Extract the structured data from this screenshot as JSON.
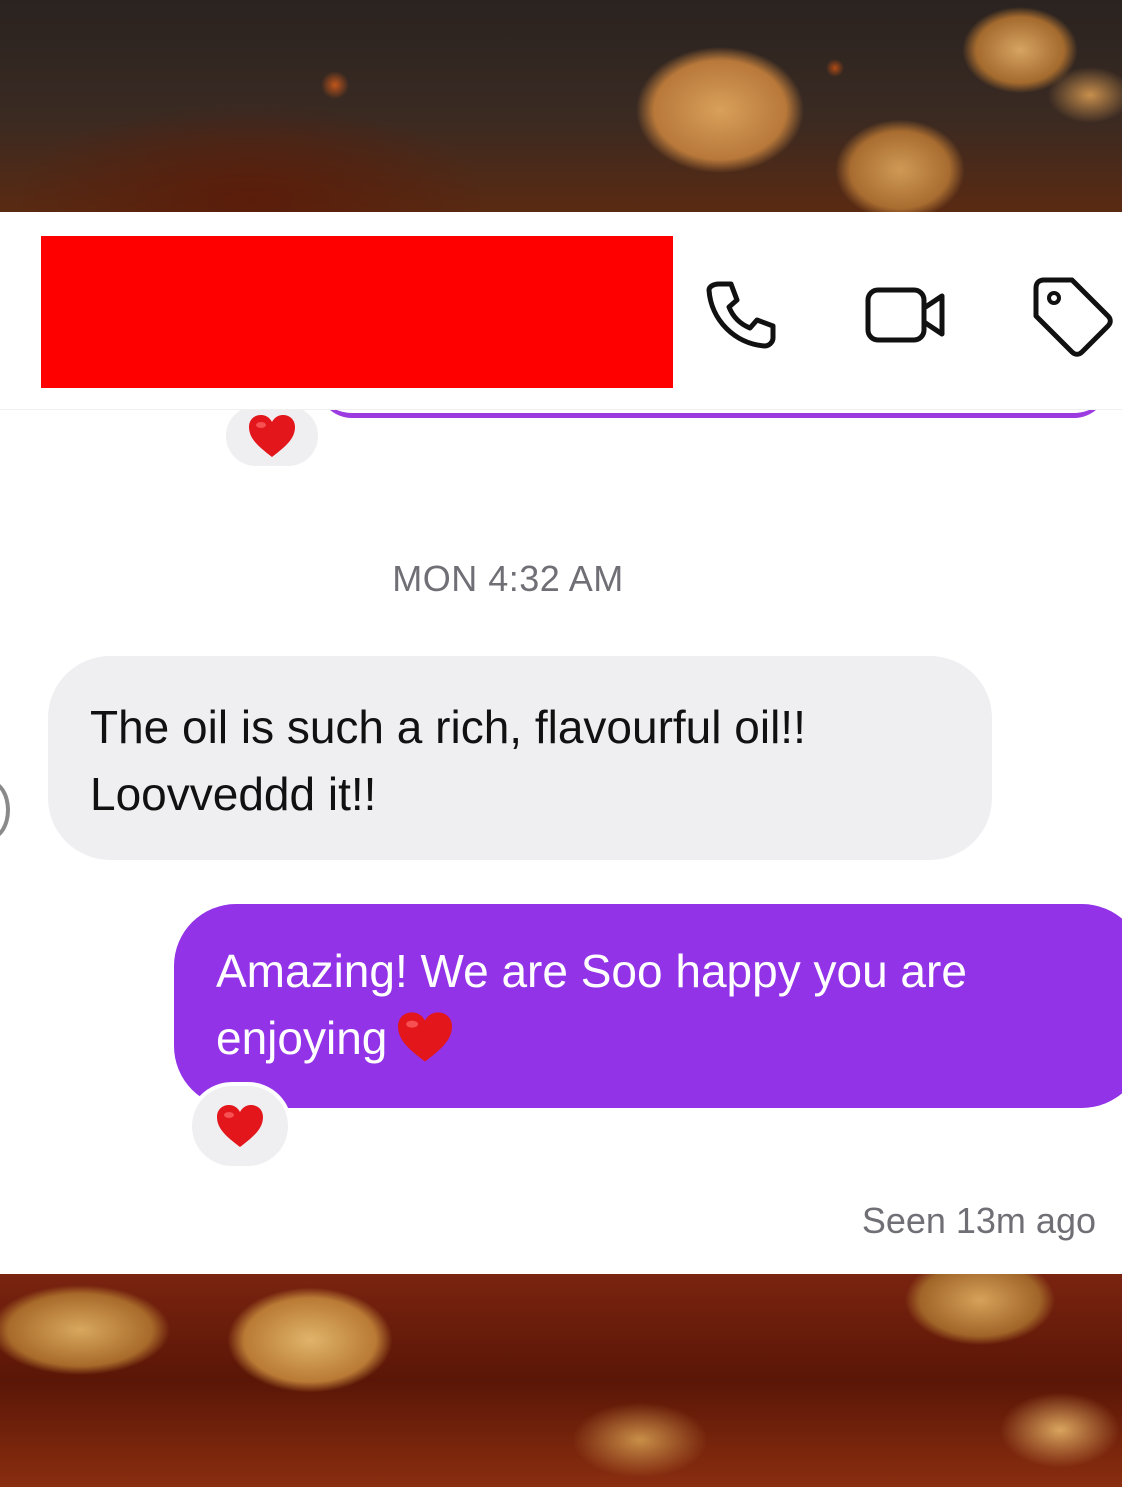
{
  "header": {
    "redacted_name": "",
    "icons": [
      "phone-icon",
      "video-camera-icon",
      "tag-icon"
    ]
  },
  "chat": {
    "timestamp": "MON 4:32 AM",
    "incoming": {
      "line1": "The oil is such a rich, flavourful oil!!",
      "line2": "Loovveddd it!!"
    },
    "outgoing": {
      "line1": "Amazing! We are Soo happy you are",
      "line2": "enjoying"
    },
    "reactions": [
      "heart-emoji",
      "heart-emoji"
    ],
    "status": "Seen 13m ago"
  },
  "colors": {
    "accent_purple": "#9233e8",
    "incoming_bubble": "#efeff2",
    "redaction": "#ff0000",
    "meta_text": "#6f6f75"
  }
}
